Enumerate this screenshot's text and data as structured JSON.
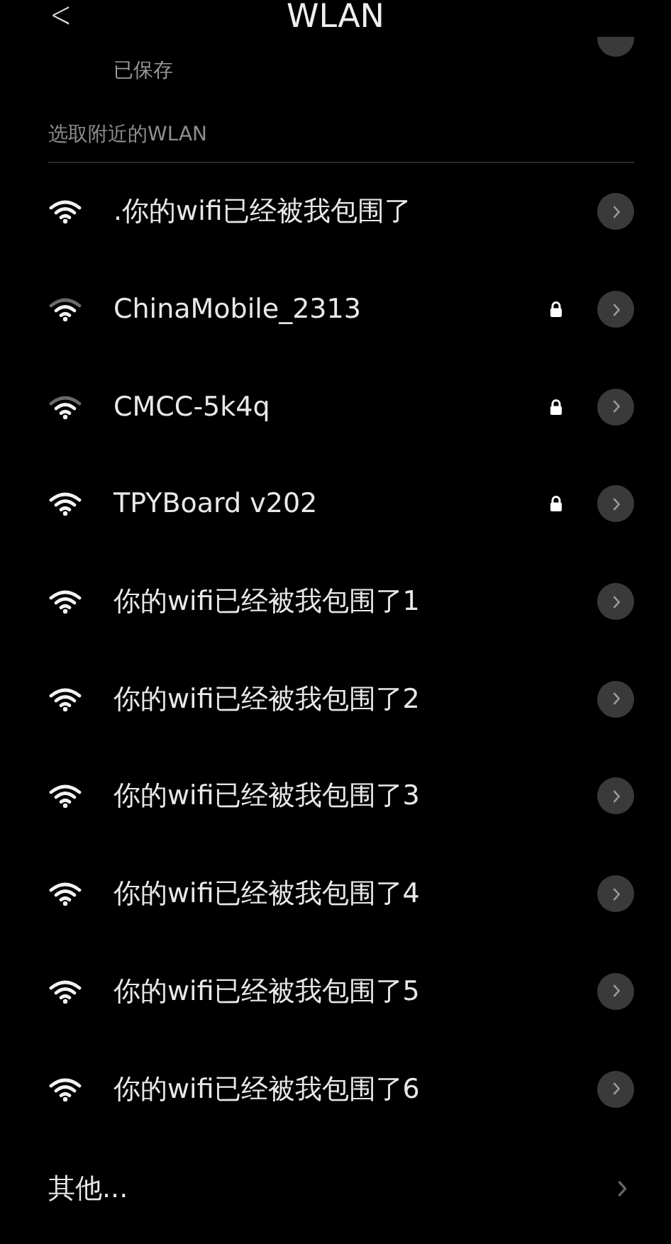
{
  "header": {
    "back": "<",
    "title": "WLAN"
  },
  "saved": {
    "status": "已保存"
  },
  "section": {
    "title": "选取附近的WLAN"
  },
  "networks": [
    {
      "name": ".你的wifi已经被我包围了",
      "weak_signal": false,
      "locked": false
    },
    {
      "name": "ChinaMobile_2313",
      "weak_signal": true,
      "locked": true
    },
    {
      "name": "CMCC-5k4q",
      "weak_signal": true,
      "locked": true
    },
    {
      "name": "TPYBoard v202",
      "weak_signal": false,
      "locked": true
    },
    {
      "name": "你的wifi已经被我包围了1",
      "weak_signal": false,
      "locked": false
    },
    {
      "name": "你的wifi已经被我包围了2",
      "weak_signal": false,
      "locked": false
    },
    {
      "name": "你的wifi已经被我包围了3",
      "weak_signal": false,
      "locked": false
    },
    {
      "name": "你的wifi已经被我包围了4",
      "weak_signal": false,
      "locked": false
    },
    {
      "name": "你的wifi已经被我包围了5",
      "weak_signal": false,
      "locked": false
    },
    {
      "name": "你的wifi已经被我包围了6",
      "weak_signal": false,
      "locked": false
    }
  ],
  "other": {
    "label": "其他..."
  }
}
